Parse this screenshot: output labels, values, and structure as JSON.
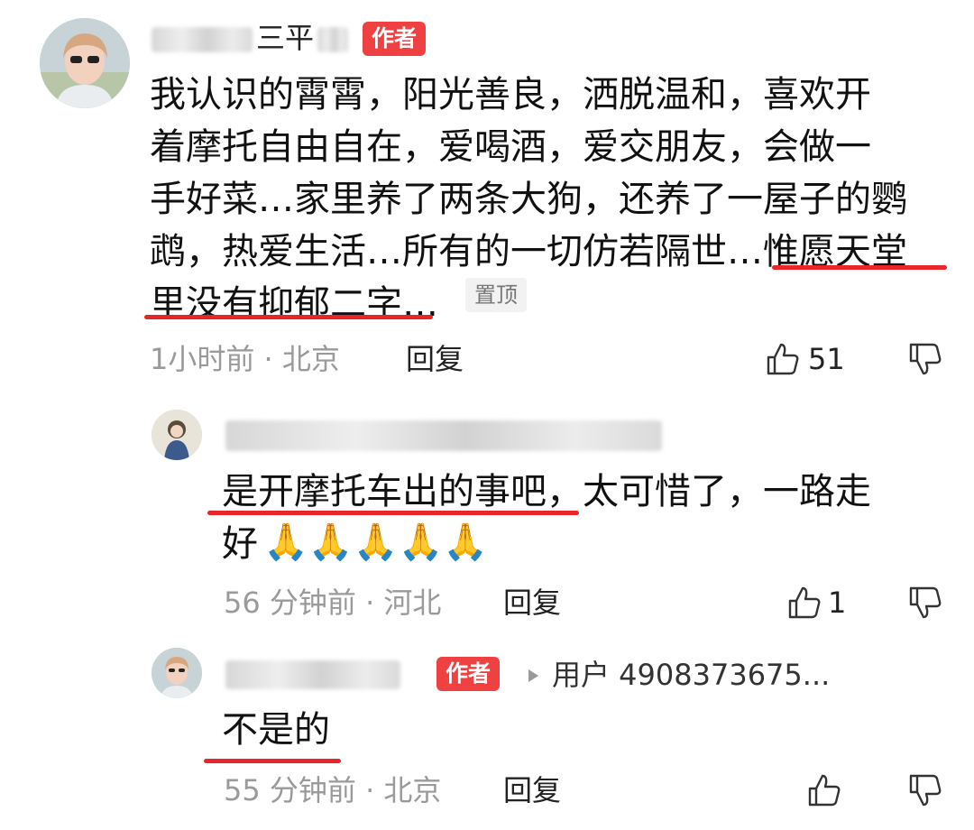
{
  "comments": [
    {
      "username": "三平",
      "badge": "作者",
      "lines": [
        "我认识的霄霄，阳光善良，洒脱温和，喜欢开",
        "着摩托自由自在，爱喝酒，爱交朋友，会做一",
        "手好菜…家里养了两条大狗，还养了一屋子的鹦",
        "鹉，热爱生活…所有的一切仿若隔世…惟愿天堂",
        "里没有抑郁二字…"
      ],
      "pinned": "置顶",
      "meta": "1小时前 · 北京",
      "reply_label": "回复",
      "likes": "51"
    },
    {
      "lines": [
        "是开摩托车出的事吧，太可惜了，一路走",
        "好"
      ],
      "emojis": [
        "🙏",
        "🙏",
        "🙏",
        "🙏",
        "🙏"
      ],
      "meta": "56 分钟前 · 河北",
      "reply_label": "回复",
      "likes": "1"
    },
    {
      "badge": "作者",
      "reply_to": "用户 4908373675...",
      "lines": [
        "不是的"
      ],
      "meta": "55 分钟前 · 北京",
      "reply_label": "回复"
    }
  ],
  "colors": {
    "badge": "#f04142",
    "underline": "#e8252b",
    "meta": "#9a9a9a"
  },
  "icons": [
    "thumbs-up-icon",
    "thumbs-down-icon",
    "reply-arrow-icon"
  ]
}
